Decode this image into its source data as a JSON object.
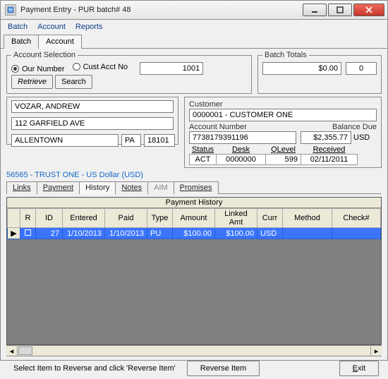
{
  "window": {
    "title": "Payment Entry - PUR batch# 48"
  },
  "menu": {
    "batch": "Batch",
    "account": "Account",
    "reports": "Reports"
  },
  "subtabs": {
    "batch": "Batch",
    "account": "Account"
  },
  "account_selection": {
    "legend": "Account Selection",
    "our_number_label": "Our Number",
    "cust_acct_label": "Cust Acct No",
    "search_value": "1001",
    "retrieve": "Retrieve",
    "search": "Search"
  },
  "batch_totals": {
    "legend": "Batch Totals",
    "amount": "$0.00",
    "count": "0"
  },
  "address": {
    "name": "VOZAR, ANDREW",
    "street": "112 GARFIELD AVE",
    "city": "ALLENTOWN",
    "state": "PA",
    "zip": "18101"
  },
  "customer": {
    "label_customer": "Customer",
    "customer": "0000001 - CUSTOMER ONE",
    "label_account_number": "Account Number",
    "account_number": "7738179391196",
    "label_balance_due": "Balance Due",
    "balance_due": "$2,355.77",
    "currency": "USD",
    "labels": {
      "status": "Status",
      "desk": "Desk",
      "qlevel": "QLevel",
      "received": "Received"
    },
    "status": "ACT",
    "desk": "0000000",
    "qlevel": "599",
    "received": "02/11/2011"
  },
  "trust_line": "56565 - TRUST ONE - US Dollar (USD)",
  "tabs2": {
    "links": "Links",
    "payment": "Payment",
    "history": "History",
    "notes": "Notes",
    "aim": "AIM",
    "promises": "Promises"
  },
  "grid": {
    "title": "Payment History",
    "headers": {
      "r": "R",
      "id": "ID",
      "entered": "Entered",
      "paid": "Paid",
      "type": "Type",
      "amount": "Amount",
      "linked_amt": "Linked Amt",
      "curr": "Curr",
      "method": "Method",
      "checkno": "Check#"
    },
    "rows": [
      {
        "r_checked": false,
        "id": "27",
        "entered": "1/10/2013",
        "paid": "1/10/2013",
        "type": "PU",
        "amount": "$100.00",
        "linked_amt": "$100.00",
        "curr": "USD",
        "method": "",
        "checkno": ""
      }
    ]
  },
  "footer": {
    "hint": "Select Item to Reverse and click 'Reverse Item'",
    "reverse": "Reverse Item",
    "exit_e": "E",
    "exit_rest": "xit"
  }
}
